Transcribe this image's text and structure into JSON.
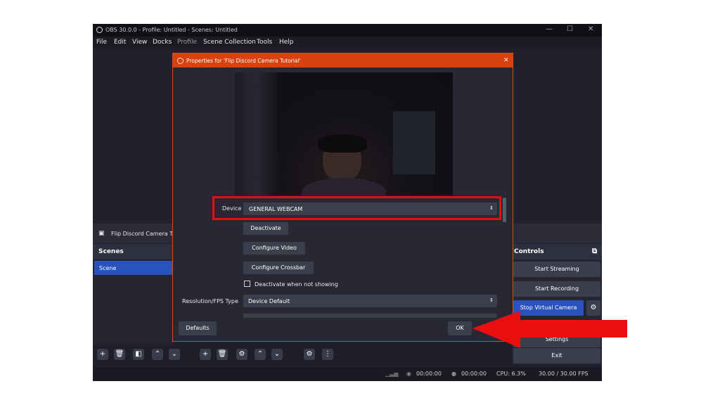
{
  "window": {
    "title": "OBS 30.0.0 - Profile: Untitled - Scenes: Untitled",
    "min": "—",
    "max": "☐",
    "close": "✕"
  },
  "menu": [
    "File",
    "Edit",
    "View",
    "Docks",
    "Profile",
    "Scene Collection",
    "Tools",
    "Help"
  ],
  "source_bar": {
    "label": "Flip Discord Camera T"
  },
  "scenes": {
    "title": "Scenes",
    "items": [
      "Scene"
    ]
  },
  "controls": {
    "title": "Controls",
    "buttons": [
      "Start Streaming",
      "Start Recording",
      "Stop Virtual Camera",
      "Settings",
      "Exit"
    ]
  },
  "status": {
    "stream_time": "00:00:00",
    "rec_time": "00:00:00",
    "cpu": "CPU: 6.3%",
    "fps": "30.00 / 30.00 FPS"
  },
  "dialog": {
    "title": "Properties for 'Flip Discord Camera Tutorial'",
    "close": "✕",
    "device_label": "Device",
    "device_value": "GENERAL WEBCAM",
    "deactivate": "Deactivate",
    "configure_video": "Configure Video",
    "configure_crossbar": "Configure Crossbar",
    "deactivate_when_not_showing": "Deactivate when not showing",
    "resolution_label": "Resolution/FPS Type",
    "resolution_value": "Device Default",
    "defaults": "Defaults",
    "ok": "OK"
  },
  "colors": {
    "accent": "#d9410f",
    "highlight": "#e01010",
    "selected": "#2a52be"
  }
}
